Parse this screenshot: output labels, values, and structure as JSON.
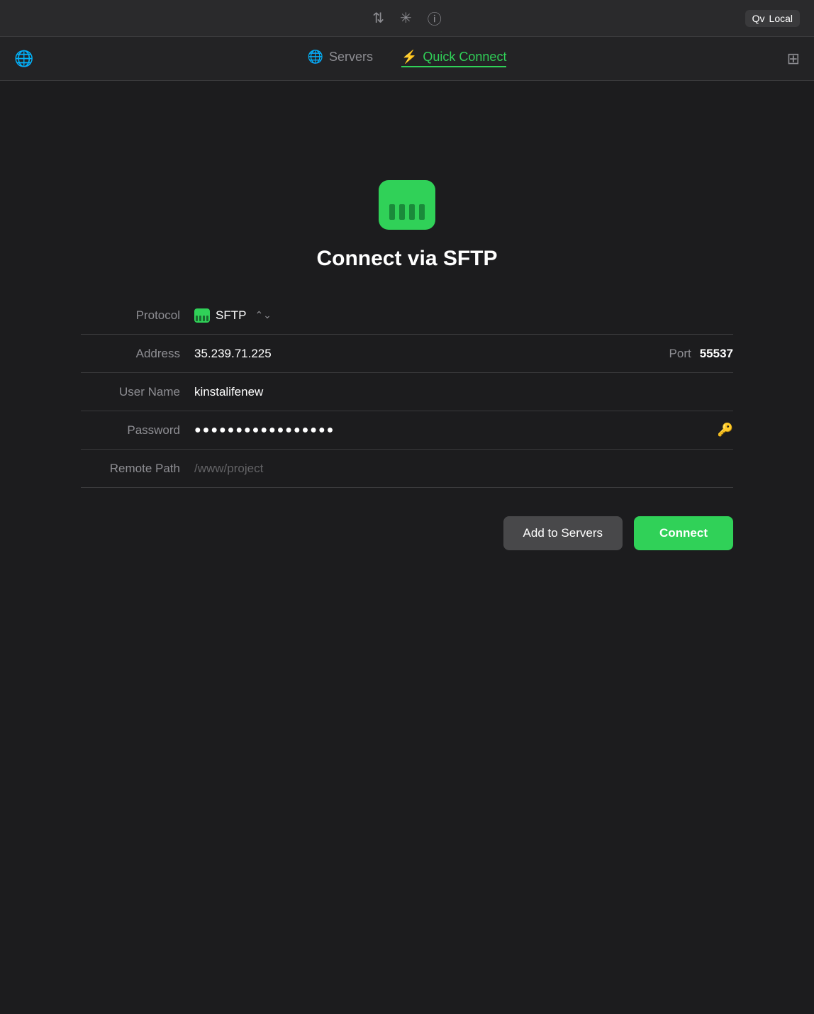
{
  "titlebar": {
    "icons": [
      "transfer-icon",
      "spinner-icon",
      "info-icon"
    ],
    "local_label": "Local",
    "local_prefix": "Qv"
  },
  "tabs": {
    "servers_label": "Servers",
    "quick_connect_label": "Quick Connect",
    "lightning": "⚡"
  },
  "form": {
    "connect_title": "Connect via SFTP",
    "protocol_label": "Protocol",
    "protocol_value": "SFTP",
    "address_label": "Address",
    "address_value": "35.239.71.225",
    "port_label": "Port",
    "port_value": "55537",
    "username_label": "User Name",
    "username_value": "kinstalifenew",
    "password_label": "Password",
    "password_value": "●●●●●●●●●●●●●●●●●",
    "remote_path_label": "Remote Path",
    "remote_path_value": "/www/project"
  },
  "buttons": {
    "add_to_servers": "Add to Servers",
    "connect": "Connect"
  }
}
